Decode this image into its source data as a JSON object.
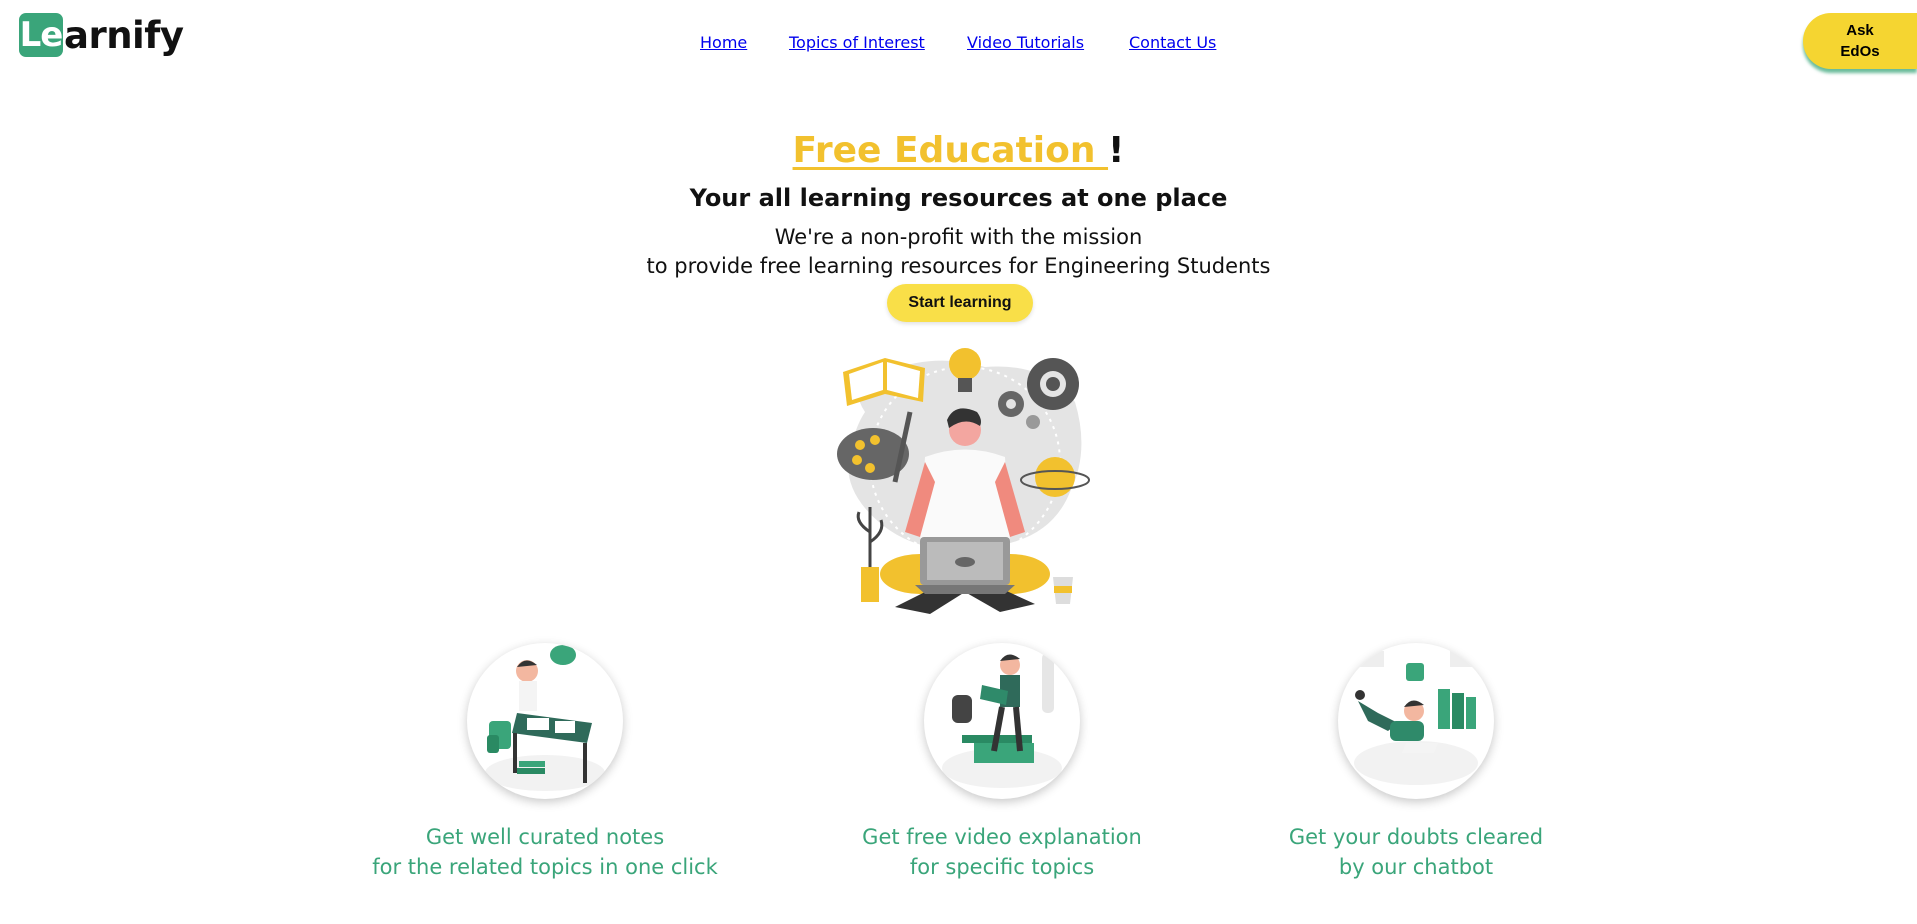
{
  "brand": {
    "logo_box": "Le",
    "logo_rest": "arnify"
  },
  "nav": {
    "items": [
      "Home",
      "Topics of Interest",
      "Video Tutorials",
      "Contact Us"
    ]
  },
  "ask_button": {
    "line1": "Ask",
    "line2": "EdOs"
  },
  "hero": {
    "title_highlight": "Free Education ",
    "title_suffix": "!",
    "subtitle": "Your all learning resources at one place",
    "desc_line1": "We're a non-profit with the mission",
    "desc_line2": "to provide free learning resources for Engineering Students",
    "cta": "Start learning"
  },
  "features": [
    {
      "line1": "Get well curated notes",
      "line2": "for the related topics in one click"
    },
    {
      "line1": "Get free video explanation",
      "line2": "for specific topics"
    },
    {
      "line1": "Get your doubts cleared",
      "line2": "by our chatbot"
    }
  ],
  "colors": {
    "brand_green": "#3aa57a",
    "accent_yellow": "#f5d531",
    "title_yellow": "#f2c12e"
  }
}
